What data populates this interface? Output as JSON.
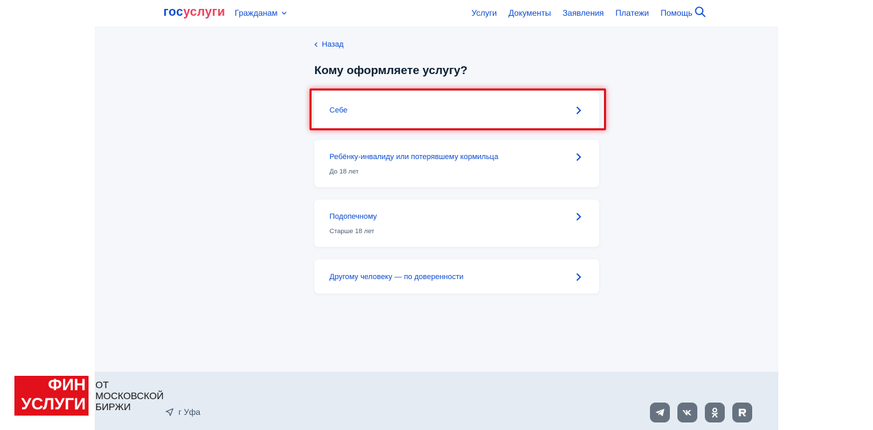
{
  "header": {
    "logo": {
      "part1": "гос",
      "part2": "услуги"
    },
    "audience": "Гражданам",
    "nav": [
      "Услуги",
      "Документы",
      "Заявления",
      "Платежи",
      "Помощь"
    ]
  },
  "back_label": "Назад",
  "title": "Кому оформляете услугу?",
  "options": [
    {
      "label": "Себе",
      "sub": ""
    },
    {
      "label": "Ребёнку-инвалиду или потерявшему кормильца",
      "sub": "До 18 лет"
    },
    {
      "label": "Подопечному",
      "sub": "Старше 18 лет"
    },
    {
      "label": "Другому человеку — по доверенности",
      "sub": ""
    }
  ],
  "footer": {
    "city": "г Уфа",
    "socials": [
      "telegram-icon",
      "vk-icon",
      "ok-icon",
      "rutube-icon"
    ]
  },
  "watermark": {
    "box_lines": [
      "ФИН",
      "УСЛУГИ"
    ],
    "text_lines": [
      "ОТ",
      "МОСКОВСКОЙ",
      "БИРЖИ"
    ]
  },
  "colors": {
    "link": "#0d4cd3",
    "brand_red": "#ee3f58",
    "highlight": "#e2101a",
    "background": "#f5f7fb"
  }
}
